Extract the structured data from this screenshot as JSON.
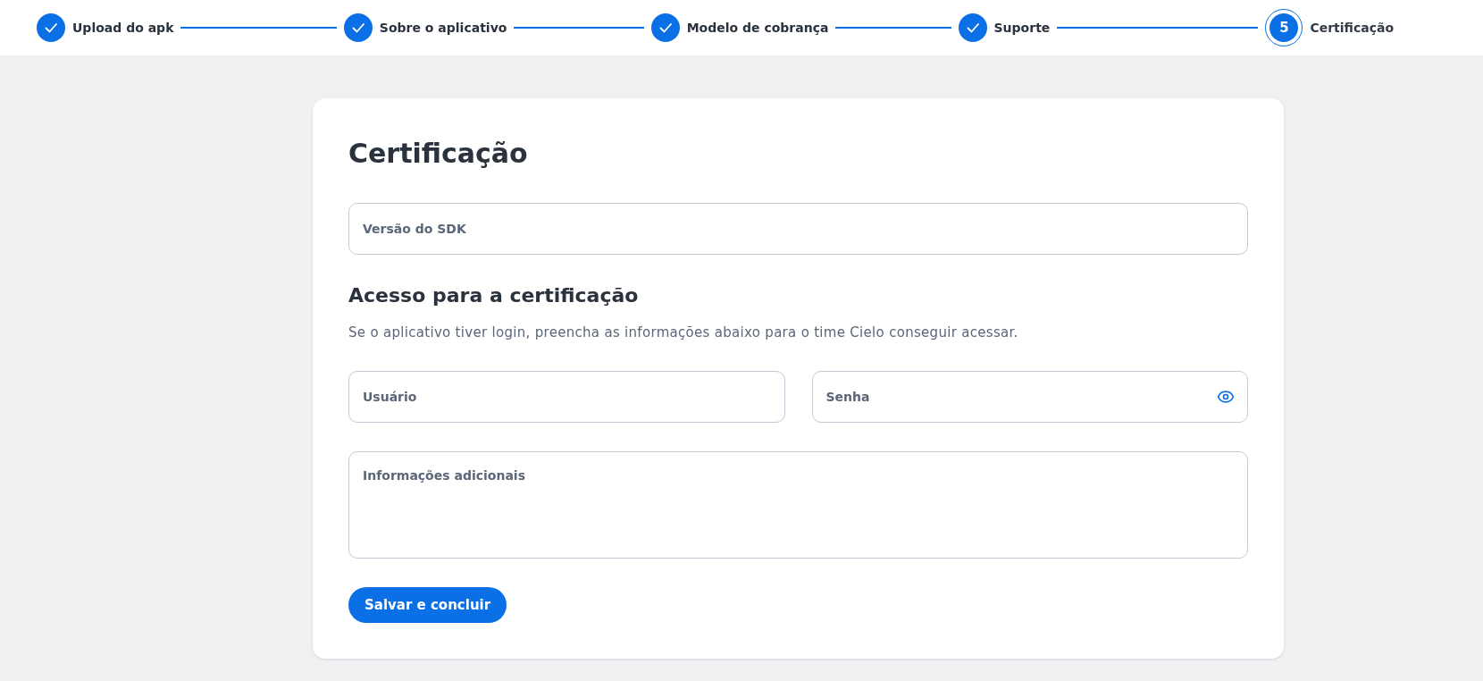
{
  "steps": [
    {
      "label": "Upload do apk",
      "completed": true,
      "current": false
    },
    {
      "label": "Sobre o aplicativo",
      "completed": true,
      "current": false
    },
    {
      "label": "Modelo de cobrança",
      "completed": true,
      "current": false
    },
    {
      "label": "Suporte",
      "completed": true,
      "current": false
    },
    {
      "label": "Certificação",
      "number": "5",
      "completed": false,
      "current": true
    }
  ],
  "form": {
    "title": "Certificação",
    "sdk_field": {
      "placeholder": "Versão do SDK"
    },
    "access_section": {
      "heading": "Acesso para a certificação",
      "description": "Se o aplicativo tiver login, preencha as informações abaixo para o time Cielo conseguir acessar.",
      "user_field": {
        "placeholder": "Usuário"
      },
      "password_field": {
        "placeholder": "Senha",
        "show_toggle": true
      },
      "notes_field": {
        "placeholder": "Informações adicionais"
      }
    },
    "submit_button": {
      "label": "Salvar e concluir"
    }
  }
}
